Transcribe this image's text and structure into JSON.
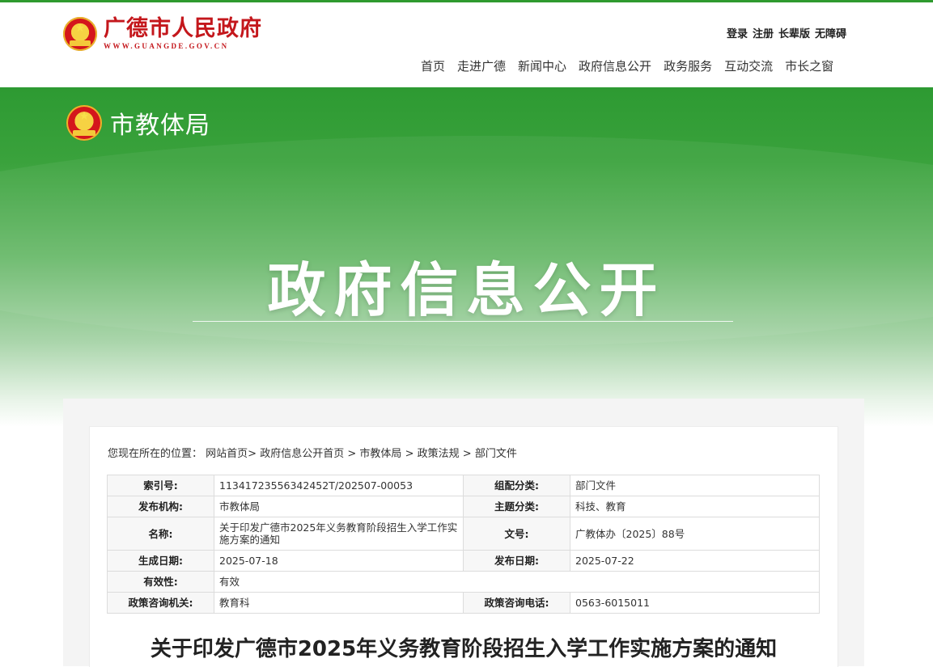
{
  "site": {
    "title": "广德市人民政府",
    "url": "WWW.GUANGDE.GOV.CN"
  },
  "toplinks": [
    "登录",
    "注册",
    "长辈版",
    "无障碍"
  ],
  "nav": [
    "首页",
    "走进广德",
    "新闻中心",
    "政府信息公开",
    "政务服务",
    "互动交流",
    "市长之窗"
  ],
  "dept": "市教体局",
  "banner_title": "政府信息公开",
  "breadcrumb": {
    "label": "您现在所在的位置：",
    "items": [
      "网站首页>",
      "政府信息公开首页",
      ">",
      "市教体局",
      ">",
      "政策法规",
      ">",
      "部门文件"
    ]
  },
  "meta": {
    "index_label": "索引号:",
    "index_value": "11341723556342452T/202507-00053",
    "category_label": "组配分类:",
    "category_value": "部门文件",
    "publisher_label": "发布机构:",
    "publisher_value": "市教体局",
    "topic_label": "主题分类:",
    "topic_value": "科技、教育",
    "name_label": "名称:",
    "name_value": "关于印发广德市2025年义务教育阶段招生入学工作实施方案的通知",
    "docno_label": "文号:",
    "docno_value": "广教体办〔2025〕88号",
    "created_label": "生成日期:",
    "created_value": "2025-07-18",
    "published_label": "发布日期:",
    "published_value": "2025-07-22",
    "validity_label": "有效性:",
    "validity_value": "有效",
    "consult_org_label": "政策咨询机关:",
    "consult_org_value": "教育科",
    "consult_tel_label": "政策咨询电话:",
    "consult_tel_value": "0563-6015011"
  },
  "doc_title": "关于印发广德市2025年义务教育阶段招生入学工作实施方案的通知",
  "colors": {
    "brand_green": "#2e9a2e",
    "brand_red": "#c4171c"
  },
  "icons": [
    "national-emblem-icon"
  ]
}
